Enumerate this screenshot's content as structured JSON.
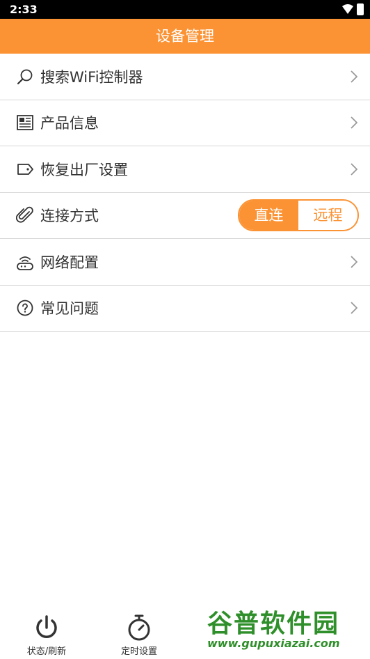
{
  "status_bar": {
    "time": "2:33"
  },
  "header": {
    "title": "设备管理"
  },
  "menu": [
    {
      "icon": "search-icon",
      "label": "搜索WiFi控制器"
    },
    {
      "icon": "newspaper-icon",
      "label": "产品信息"
    },
    {
      "icon": "tag-icon",
      "label": "恢复出厂设置"
    },
    {
      "icon": "paperclip-icon",
      "label": "连接方式",
      "options": [
        "直连",
        "远程"
      ],
      "selected": "直连"
    },
    {
      "icon": "router-icon",
      "label": "网络配置"
    },
    {
      "icon": "help-circle-icon",
      "label": "常见问题"
    }
  ],
  "tabs": [
    {
      "icon": "power-icon",
      "label": "状态/刷新"
    },
    {
      "icon": "stopwatch-icon",
      "label": "定时设置"
    }
  ],
  "watermark": {
    "brand": "谷普软件园",
    "url": "www.gupuxiazai.com"
  },
  "colors": {
    "accent": "#fb9233"
  }
}
